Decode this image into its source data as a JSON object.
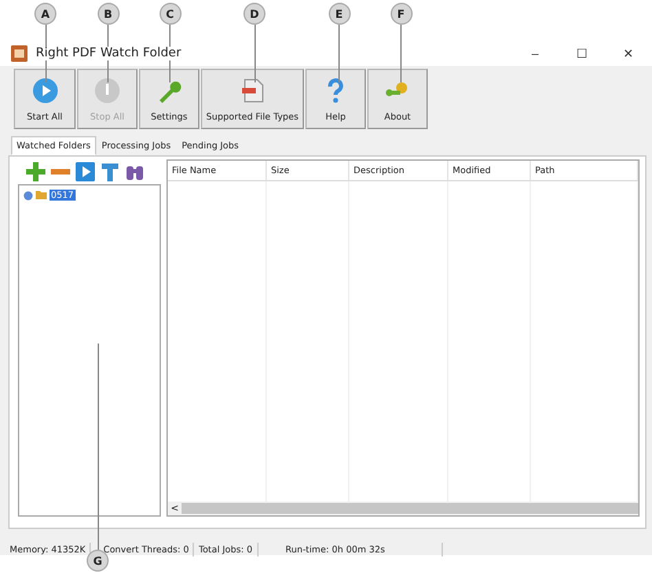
{
  "callouts": [
    {
      "letter": "A"
    },
    {
      "letter": "B"
    },
    {
      "letter": "C"
    },
    {
      "letter": "D"
    },
    {
      "letter": "E"
    },
    {
      "letter": "F"
    }
  ],
  "bottom_callout": {
    "letter": "G"
  },
  "window": {
    "title": "Right PDF Watch Folder",
    "controls": [
      "–",
      "☐",
      "✕"
    ]
  },
  "toolbar": [
    {
      "label": "Start All",
      "disabled": false
    },
    {
      "label": "Stop All",
      "disabled": true
    },
    {
      "label": "Settings",
      "disabled": false
    },
    {
      "label": "Supported File Types",
      "disabled": false
    },
    {
      "label": "Help",
      "disabled": false
    },
    {
      "label": "About",
      "disabled": false
    }
  ],
  "tabs": [
    {
      "label": "Watched Folders",
      "selected": true
    },
    {
      "label": "Processing Jobs",
      "selected": false
    },
    {
      "label": "Pending Jobs",
      "selected": false
    }
  ],
  "tree": [
    {
      "label": "0517",
      "selected": true
    }
  ],
  "table": {
    "columns": [
      "File Name",
      "Size",
      "Description",
      "Modified",
      "Path"
    ]
  },
  "scrollbar_arrow": "<",
  "status_bar": [
    "Memory: 41352K",
    "Convert Threads: 0",
    "Total Jobs: 0",
    "Run-time: 0h 00m 32s"
  ]
}
